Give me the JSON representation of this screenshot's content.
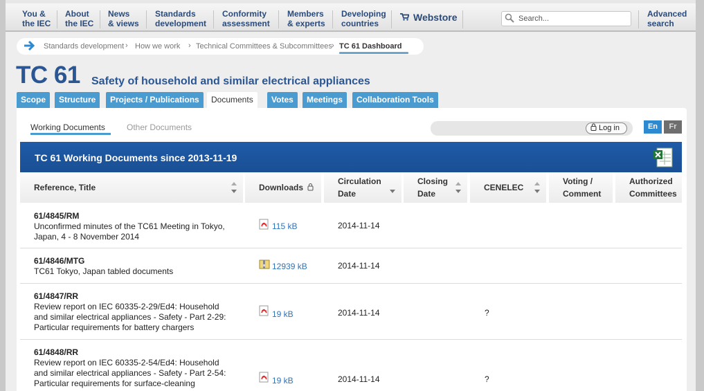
{
  "nav": {
    "items": [
      {
        "line1": "You &",
        "line2": "the IEC"
      },
      {
        "line1": "About",
        "line2": "the IEC"
      },
      {
        "line1": "News",
        "line2": "& views"
      },
      {
        "line1": "Standards",
        "line2": "development"
      },
      {
        "line1": "Conformity",
        "line2": "assessment"
      },
      {
        "line1": "Members",
        "line2": "& experts"
      },
      {
        "line1": "Developing",
        "line2": "countries"
      }
    ],
    "webstore": "Webstore",
    "search_placeholder": "Search...",
    "advanced": {
      "line1": "Advanced",
      "line2": "search"
    }
  },
  "breadcrumb": {
    "items": [
      "Standards development",
      "How we work",
      "Technical Committees & Subcommittees"
    ],
    "current": "TC 61 Dashboard"
  },
  "header": {
    "title": "TC 61",
    "subtitle": "Safety of household and similar electrical appliances"
  },
  "tabs": [
    "Scope",
    "Structure",
    "Projects / Publications",
    "Documents",
    "Votes",
    "Meetings",
    "Collaboration Tools"
  ],
  "subtabs": {
    "working": "Working Documents",
    "other": "Other Documents"
  },
  "login_label": "Log in",
  "lang": {
    "en": "En",
    "fr": "Fr"
  },
  "table": {
    "title": "TC 61 Working Documents since 2013-11-19",
    "columns": {
      "ref": "Reference, Title",
      "downloads": "Downloads",
      "circ1": "Circulation",
      "circ2": "Date",
      "close1": "Closing",
      "close2": "Date",
      "cenelec": "CENELEC",
      "vote1": "Voting /",
      "vote2": "Comment",
      "auth1": "Authorized",
      "auth2": "Committees"
    },
    "rows": [
      {
        "ref": "61/4845/RM",
        "t1": "Unconfirmed minutes of the TC61 Meeting in Tokyo,",
        "t2": "Japan, 4 - 8 November 2014",
        "t3": "",
        "t4": "",
        "size": "115 kB",
        "icon": "pdf-icon",
        "date": "2014-11-14",
        "cenelec": ""
      },
      {
        "ref": "61/4846/MTG",
        "t1": "TC61 Tokyo, Japan tabled documents",
        "t2": "",
        "t3": "",
        "t4": "",
        "size": "12939 kB",
        "icon": "zip-icon",
        "date": "2014-11-14",
        "cenelec": ""
      },
      {
        "ref": "61/4847/RR",
        "t1": "Review report on IEC 60335-2-29/Ed4: Household",
        "t2": "and similar electrical appliances - Safety - Part 2-29:",
        "t3": "Particular requirements for battery chargers",
        "t4": "",
        "size": "19 kB",
        "icon": "pdf-icon",
        "date": "2014-11-14",
        "cenelec": "?"
      },
      {
        "ref": "61/4848/RR",
        "t1": "Review report on IEC 60335-2-54/Ed4: Household",
        "t2": "and similar electrical appliances - Safety - Part 2-54:",
        "t3": "Particular requirements for surface-cleaning",
        "t4": "",
        "size": "19 kB",
        "icon": "pdf-icon",
        "date": "2014-11-14",
        "cenelec": "?"
      }
    ]
  }
}
